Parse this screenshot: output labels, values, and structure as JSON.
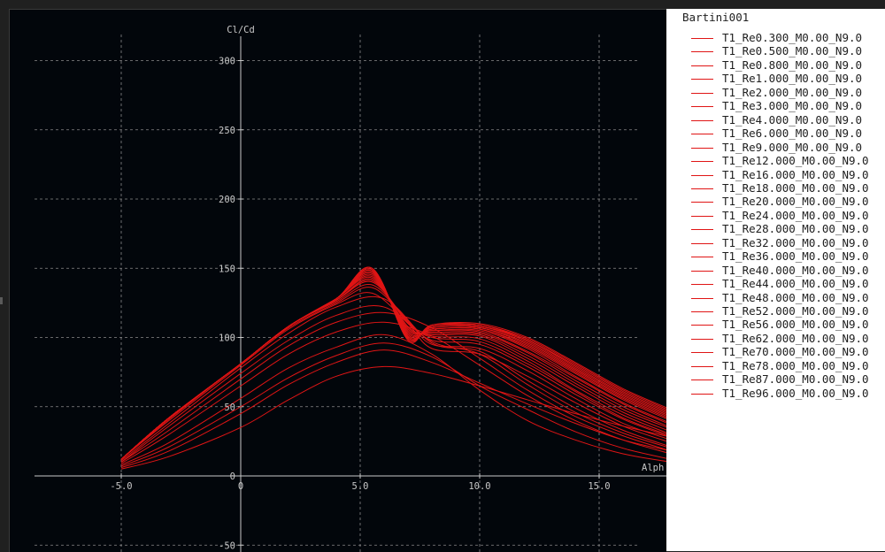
{
  "chart_data": {
    "type": "line",
    "title": "",
    "xlabel": "Alph",
    "ylabel": "Cl/Cd",
    "xlim": [
      -8.5,
      17.8
    ],
    "ylim": [
      -55,
      325
    ],
    "grid": true,
    "legend_position": "right",
    "colors": {
      "series": "#e01515",
      "grid": "#8a8a8a",
      "axis": "#c8c8c8",
      "text": "#c8c8c8",
      "background": "#02060b"
    },
    "x_ticks": [
      -5,
      0,
      5,
      10,
      15
    ],
    "x_tick_labels": [
      "-5.0",
      "0",
      "5.0",
      "10.0",
      "15.0"
    ],
    "y_ticks": [
      -50,
      0,
      50,
      100,
      150,
      200,
      250,
      300
    ],
    "y_tick_labels": [
      "-50",
      "0",
      "50",
      "100",
      "150",
      "200",
      "250",
      "300"
    ],
    "legend_title": "Bartini001",
    "series": [
      {
        "name": "T1_Re0.300_M0.00_N9.0",
        "x": [
          -5,
          -3,
          0,
          2,
          4,
          6,
          8,
          10,
          12,
          14,
          16,
          18
        ],
        "y": [
          5,
          14,
          35,
          55,
          72,
          79,
          74,
          65,
          55,
          45,
          36,
          28
        ]
      },
      {
        "name": "T1_Re0.500_M0.00_N9.0",
        "x": [
          -5,
          -3,
          0,
          2,
          4,
          6,
          8,
          10,
          12,
          14,
          16,
          18
        ],
        "y": [
          6,
          18,
          45,
          66,
          82,
          91,
          82,
          67,
          52,
          38,
          26,
          18
        ]
      },
      {
        "name": "T1_Re0.800_M0.00_N9.0",
        "x": [
          -5,
          -3,
          0,
          2,
          4,
          6,
          8,
          10,
          12,
          14,
          16,
          18
        ],
        "y": [
          7,
          21,
          50,
          71,
          87,
          96,
          86,
          65,
          48,
          32,
          20,
          12
        ]
      },
      {
        "name": "T1_Re1.000_M0.00_N9.0",
        "x": [
          -5,
          -3,
          0,
          2,
          4,
          6,
          8,
          10,
          12,
          14,
          16,
          18
        ],
        "y": [
          8,
          24,
          56,
          78,
          93,
          102,
          88,
          62,
          40,
          26,
          16,
          10
        ]
      },
      {
        "name": "T1_Re2.000_M0.00_N9.0",
        "x": [
          -5,
          -3,
          0,
          2,
          4,
          6,
          8,
          10,
          12,
          14,
          16,
          18
        ],
        "y": [
          9,
          30,
          65,
          88,
          104,
          111,
          101,
          80,
          58,
          40,
          26,
          16
        ]
      },
      {
        "name": "T1_Re3.000_M0.00_N9.0",
        "x": [
          -5,
          -3,
          0,
          2,
          4,
          6,
          8,
          10,
          12,
          14,
          16,
          18
        ],
        "y": [
          10,
          33,
          70,
          94,
          111,
          118,
          107,
          85,
          62,
          43,
          29,
          18
        ]
      },
      {
        "name": "T1_Re4.000_M0.00_N9.0",
        "x": [
          -5,
          -3,
          0,
          2,
          4,
          6,
          8,
          10,
          12,
          14,
          16,
          18
        ],
        "y": [
          10,
          36,
          74,
          98,
          116,
          122,
          97,
          88,
          66,
          46,
          31,
          20
        ]
      },
      {
        "name": "T1_Re6.000_M0.00_N9.0",
        "x": [
          -5,
          -3,
          0,
          2,
          4,
          6,
          8,
          10,
          12,
          14,
          16,
          18
        ],
        "y": [
          11,
          38,
          78,
          103,
          122,
          128,
          96,
          90,
          69,
          49,
          33,
          21
        ]
      },
      {
        "name": "T1_Re9.000_M0.00_N9.0",
        "x": [
          -5,
          -3,
          0,
          2,
          4,
          5.5,
          7,
          8,
          10,
          12,
          14,
          16,
          18
        ],
        "y": [
          12,
          40,
          80,
          106,
          124,
          132,
          110,
          92,
          88,
          72,
          53,
          36,
          24
        ]
      },
      {
        "name": "T1_Re12.000_M0.00_N9.0",
        "x": [
          -5,
          -3,
          0,
          2,
          4,
          5.5,
          7,
          8,
          10,
          12,
          14,
          16,
          18
        ],
        "y": [
          12,
          41,
          81,
          107,
          125,
          136,
          112,
          95,
          92,
          76,
          56,
          38,
          26
        ]
      },
      {
        "name": "T1_Re16.000_M0.00_N9.0",
        "x": [
          -5,
          -3,
          0,
          2,
          4,
          5.5,
          7,
          8,
          10,
          12,
          14,
          16,
          18
        ],
        "y": [
          12,
          42,
          81,
          108,
          126,
          138,
          112,
          98,
          95,
          79,
          59,
          41,
          28
        ]
      },
      {
        "name": "T1_Re18.000_M0.00_N9.0",
        "x": [
          -5,
          -3,
          0,
          2,
          4,
          5.5,
          7,
          8,
          10,
          12,
          14,
          16,
          18
        ],
        "y": [
          12,
          42,
          81,
          108,
          127,
          140,
          111,
          100,
          97,
          81,
          61,
          42,
          29
        ]
      },
      {
        "name": "T1_Re20.000_M0.00_N9.0",
        "x": [
          -5,
          -3,
          0,
          2,
          4,
          5.5,
          7,
          8,
          10,
          12,
          14,
          16,
          18
        ],
        "y": [
          12,
          42,
          81,
          108,
          127,
          141,
          110,
          101,
          99,
          83,
          62,
          44,
          30
        ]
      },
      {
        "name": "T1_Re24.000_M0.00_N9.0",
        "x": [
          -5,
          -3,
          0,
          2,
          4,
          5.5,
          7,
          8,
          10,
          12,
          14,
          16,
          18
        ],
        "y": [
          12,
          42,
          81,
          108,
          127,
          142,
          108,
          102,
          101,
          85,
          65,
          46,
          32
        ]
      },
      {
        "name": "T1_Re28.000_M0.00_N9.0",
        "x": [
          -5,
          -3,
          0,
          2,
          4,
          5.5,
          7,
          8,
          10,
          12,
          14,
          16,
          18
        ],
        "y": [
          12,
          42,
          81,
          108,
          128,
          143,
          107,
          103,
          102,
          87,
          67,
          48,
          34
        ]
      },
      {
        "name": "T1_Re32.000_M0.00_N9.0",
        "x": [
          -5,
          -3,
          0,
          2,
          4,
          5.5,
          7,
          8,
          10,
          12,
          14,
          16,
          18
        ],
        "y": [
          12,
          42,
          81,
          108,
          128,
          144,
          106,
          104,
          103,
          89,
          69,
          50,
          35
        ]
      },
      {
        "name": "T1_Re36.000_M0.00_N9.0",
        "x": [
          -5,
          -3,
          0,
          2,
          4,
          5.5,
          7,
          8,
          10,
          12,
          14,
          16,
          18
        ],
        "y": [
          12,
          42,
          81,
          108,
          128,
          145,
          105,
          105,
          104,
          90,
          71,
          52,
          37
        ]
      },
      {
        "name": "T1_Re40.000_M0.00_N9.0",
        "x": [
          -5,
          -3,
          0,
          2,
          4,
          5.5,
          7,
          8,
          10,
          12,
          14,
          16,
          18
        ],
        "y": [
          12,
          42,
          81,
          108,
          128,
          146,
          104,
          105,
          105,
          92,
          72,
          53,
          38
        ]
      },
      {
        "name": "T1_Re44.000_M0.00_N9.0",
        "x": [
          -5,
          -3,
          0,
          2,
          4,
          5.5,
          7,
          8,
          10,
          12,
          14,
          16,
          18
        ],
        "y": [
          12,
          42,
          81,
          108,
          128,
          147,
          103,
          106,
          106,
          93,
          74,
          55,
          40
        ]
      },
      {
        "name": "T1_Re48.000_M0.00_N9.0",
        "x": [
          -5,
          -3,
          0,
          2,
          4,
          5.5,
          7,
          8,
          10,
          12,
          14,
          16,
          18
        ],
        "y": [
          12,
          42,
          81,
          108,
          128,
          147,
          102,
          106,
          106,
          94,
          75,
          56,
          41
        ]
      },
      {
        "name": "T1_Re52.000_M0.00_N9.0",
        "x": [
          -5,
          -3,
          0,
          2,
          4,
          5.5,
          7,
          8,
          10,
          12,
          14,
          16,
          18
        ],
        "y": [
          12,
          42,
          81,
          108,
          128,
          148,
          101,
          107,
          107,
          95,
          76,
          57,
          42
        ]
      },
      {
        "name": "T1_Re56.000_M0.00_N9.0",
        "x": [
          -5,
          -3,
          0,
          2,
          4,
          5.5,
          7,
          8,
          10,
          12,
          14,
          16,
          18
        ],
        "y": [
          12,
          42,
          81,
          108,
          128,
          148,
          101,
          107,
          107,
          96,
          77,
          58,
          43
        ]
      },
      {
        "name": "T1_Re62.000_M0.00_N9.0",
        "x": [
          -5,
          -3,
          0,
          2,
          4,
          5.5,
          7,
          8,
          10,
          12,
          14,
          16,
          18
        ],
        "y": [
          12,
          42,
          81,
          108,
          128,
          149,
          100,
          108,
          108,
          97,
          78,
          59,
          44
        ]
      },
      {
        "name": "T1_Re70.000_M0.00_N9.0",
        "x": [
          -5,
          -3,
          0,
          2,
          4,
          5.5,
          7,
          8,
          10,
          12,
          14,
          16,
          18
        ],
        "y": [
          12,
          42,
          81,
          108,
          128,
          149,
          100,
          108,
          108,
          98,
          79,
          60,
          45
        ]
      },
      {
        "name": "T1_Re78.000_M0.00_N9.0",
        "x": [
          -5,
          -3,
          0,
          2,
          4,
          5.5,
          7,
          8,
          10,
          12,
          14,
          16,
          18
        ],
        "y": [
          12,
          42,
          81,
          108,
          128,
          150,
          99,
          108,
          109,
          98,
          80,
          61,
          46
        ]
      },
      {
        "name": "T1_Re87.000_M0.00_N9.0",
        "x": [
          -5,
          -3,
          0,
          2,
          4,
          5.5,
          7,
          8,
          10,
          12,
          14,
          16,
          18
        ],
        "y": [
          12,
          42,
          81,
          108,
          128,
          150,
          99,
          109,
          109,
          99,
          81,
          62,
          47
        ]
      },
      {
        "name": "T1_Re96.000_M0.00_N9.0",
        "x": [
          -5,
          -3,
          0,
          2,
          4,
          5.5,
          7,
          8,
          10,
          12,
          14,
          16,
          18
        ],
        "y": [
          12,
          42,
          81,
          108,
          128,
          150,
          98,
          109,
          110,
          100,
          82,
          63,
          48
        ]
      }
    ]
  }
}
